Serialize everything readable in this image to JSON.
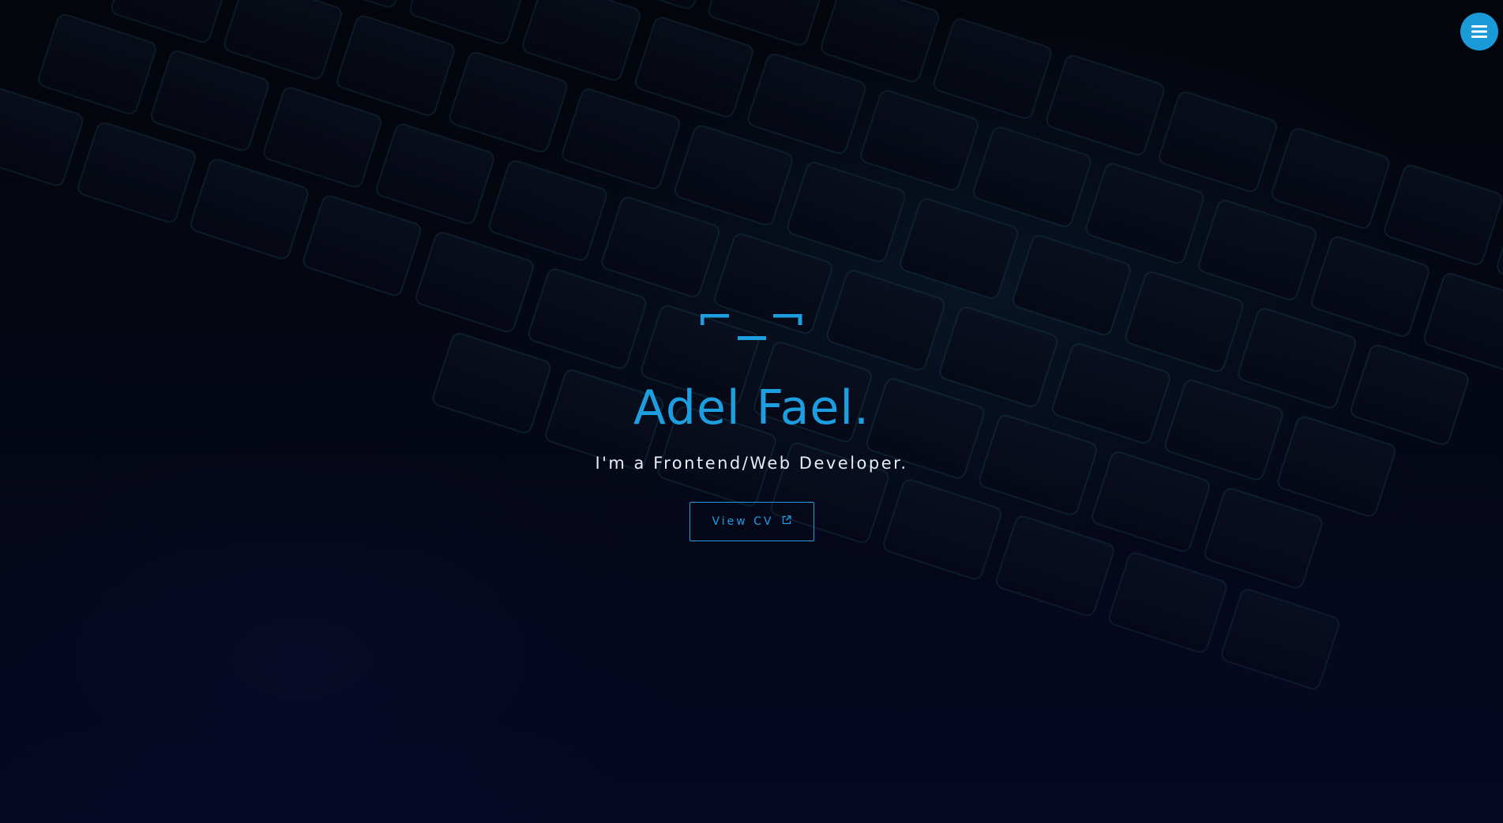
{
  "menu": {
    "icon": "hamburger-menu-icon",
    "accent": "#1a9ad6"
  },
  "hero": {
    "logo_icon": "bracket-logo-icon",
    "name": "Adel Fael.",
    "tagline": "I'm a Frontend/Web Developer.",
    "cv_button_label": "View CV",
    "cv_button_icon": "external-link-icon"
  },
  "colors": {
    "accent": "#1d9ee0",
    "background": "#05070f",
    "tagline": "#e8edf5"
  },
  "background": {
    "description_icon": "keyboard-photo-background"
  }
}
